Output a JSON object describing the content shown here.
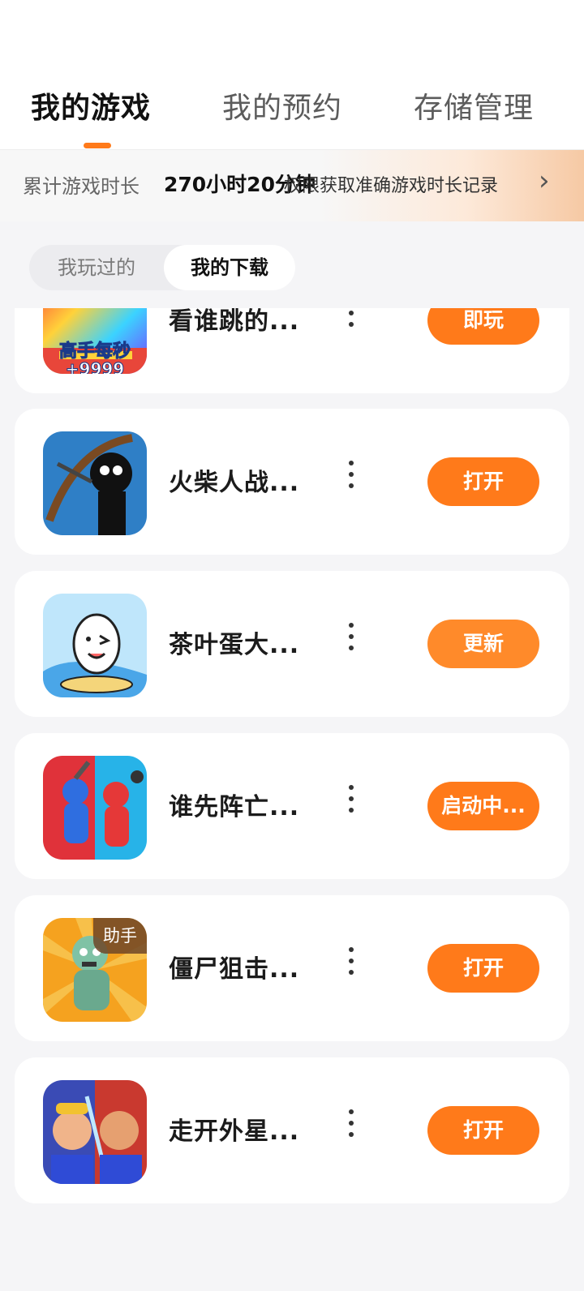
{
  "tabs": [
    {
      "label": "我的游戏",
      "active": true
    },
    {
      "label": "我的预约",
      "active": false
    },
    {
      "label": "存储管理",
      "active": false
    }
  ],
  "playtime": {
    "label": "累计游戏时长",
    "value": "270小时20分钟",
    "hint": "权限获取准确游戏时长记录",
    "chevron": "›"
  },
  "segment": [
    {
      "label": "我玩过的",
      "active": false
    },
    {
      "label": "我的下载",
      "active": true
    }
  ],
  "games": [
    {
      "name": "看谁跳的...",
      "action": "即玩",
      "icon": "jump-game-icon",
      "icon_text_1": "高手每秒",
      "icon_text_2": "+9999"
    },
    {
      "name": "火柴人战...",
      "action": "打开",
      "icon": "stickman-game-icon"
    },
    {
      "name": "茶叶蛋大...",
      "action": "更新",
      "icon": "egg-game-icon"
    },
    {
      "name": "谁先阵亡...",
      "action": "启动中...",
      "icon": "fighter-game-icon"
    },
    {
      "name": "僵尸狙击...",
      "action": "打开",
      "icon": "zombie-game-icon",
      "badge": "助手"
    },
    {
      "name": "走开外星...",
      "action": "打开",
      "icon": "alien-game-icon"
    }
  ],
  "colors": {
    "accent": "#ff7a1a",
    "update_button": "#ff8a2a"
  }
}
